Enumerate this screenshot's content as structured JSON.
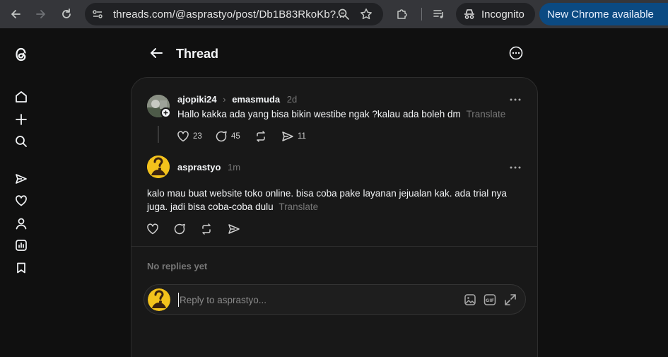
{
  "browser": {
    "url": "threads.com/@asprastyo/post/Db1B83RkoKb?...",
    "incognito_label": "Incognito",
    "update_label": "New Chrome available"
  },
  "header": {
    "title": "Thread"
  },
  "parent_post": {
    "username": "ajopiki24",
    "reply_to": "emasmuda",
    "time": "2d",
    "text": "Hallo kakka ada yang bisa bikin westibe ngak ?kalau ada boleh dm",
    "translate": "Translate",
    "likes": "23",
    "replies": "45",
    "shares": "11"
  },
  "reply_post": {
    "username": "asprastyo",
    "time": "1m",
    "text": "kalo mau buat website toko online. bisa coba pake layanan jejualan kak. ada trial nya juga. jadi bisa coba-coba dulu",
    "translate": "Translate"
  },
  "replies_section": {
    "empty_label": "No replies yet"
  },
  "reply_composer": {
    "placeholder": "Reply to asprastyo..."
  },
  "colors": {
    "background": "#101010",
    "card": "#181818",
    "chrome_bar": "#35363a",
    "update_pill": "#0b4a82",
    "muted_text": "#777777"
  }
}
